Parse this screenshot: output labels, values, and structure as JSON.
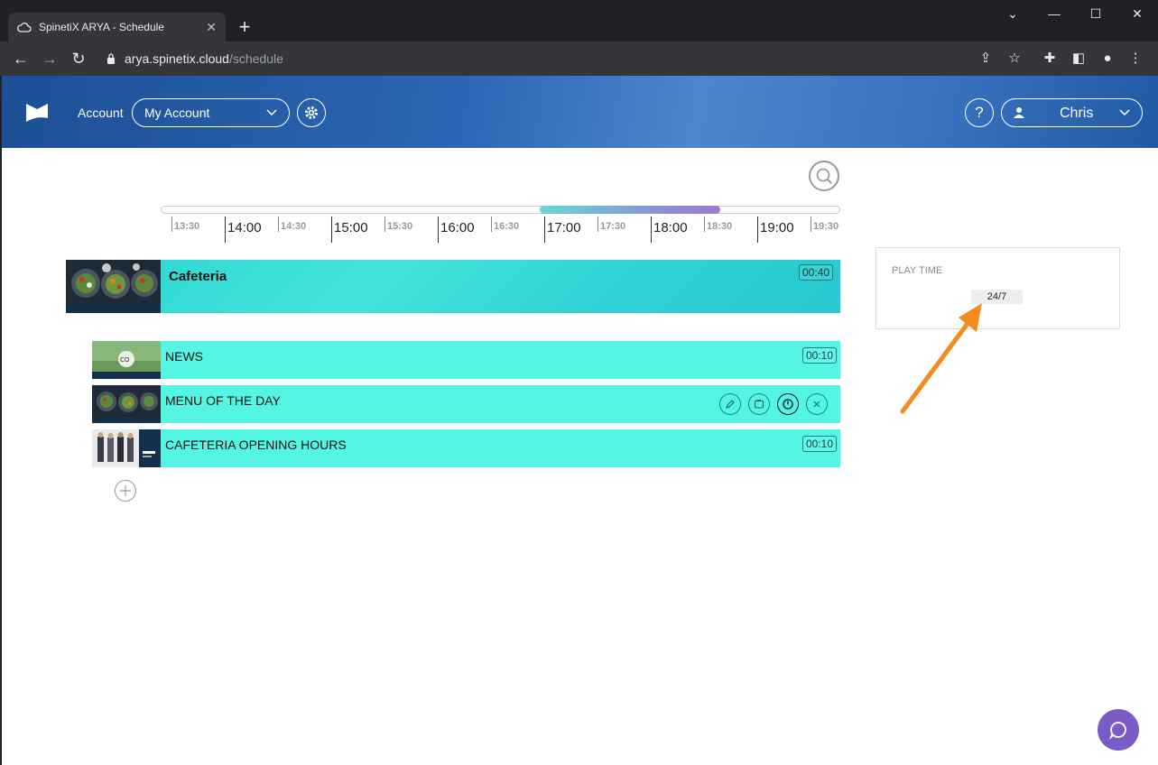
{
  "browser": {
    "tab_title": "SpinetiX ARYA - Schedule",
    "url_host": "arya.spinetix.cloud",
    "url_path": "/schedule"
  },
  "header": {
    "account_label": "Account",
    "account_value": "My Account",
    "help_label": "?",
    "user_name": "Chris"
  },
  "timeline": {
    "major_ticks": [
      "14:00",
      "15:00",
      "16:00",
      "17:00",
      "18:00",
      "19:00"
    ],
    "minor_ticks": [
      "13:30",
      "14:30",
      "15:30",
      "16:30",
      "17:30",
      "18:30",
      "19:30"
    ]
  },
  "playlist": {
    "title": "Cafeteria",
    "duration": "00:40",
    "items": [
      {
        "title": "NEWS",
        "duration": "00:10"
      },
      {
        "title": "MENU OF THE DAY",
        "duration": ""
      },
      {
        "title": "CAFETERIA OPENING HOURS",
        "duration": "00:10"
      }
    ]
  },
  "play_time": {
    "label": "PLAY TIME",
    "value": "24/7"
  },
  "colors": {
    "accent_teal": "#55f5e4",
    "chat_purple": "#7b5cc7",
    "annotation_orange": "#f58a1f"
  }
}
